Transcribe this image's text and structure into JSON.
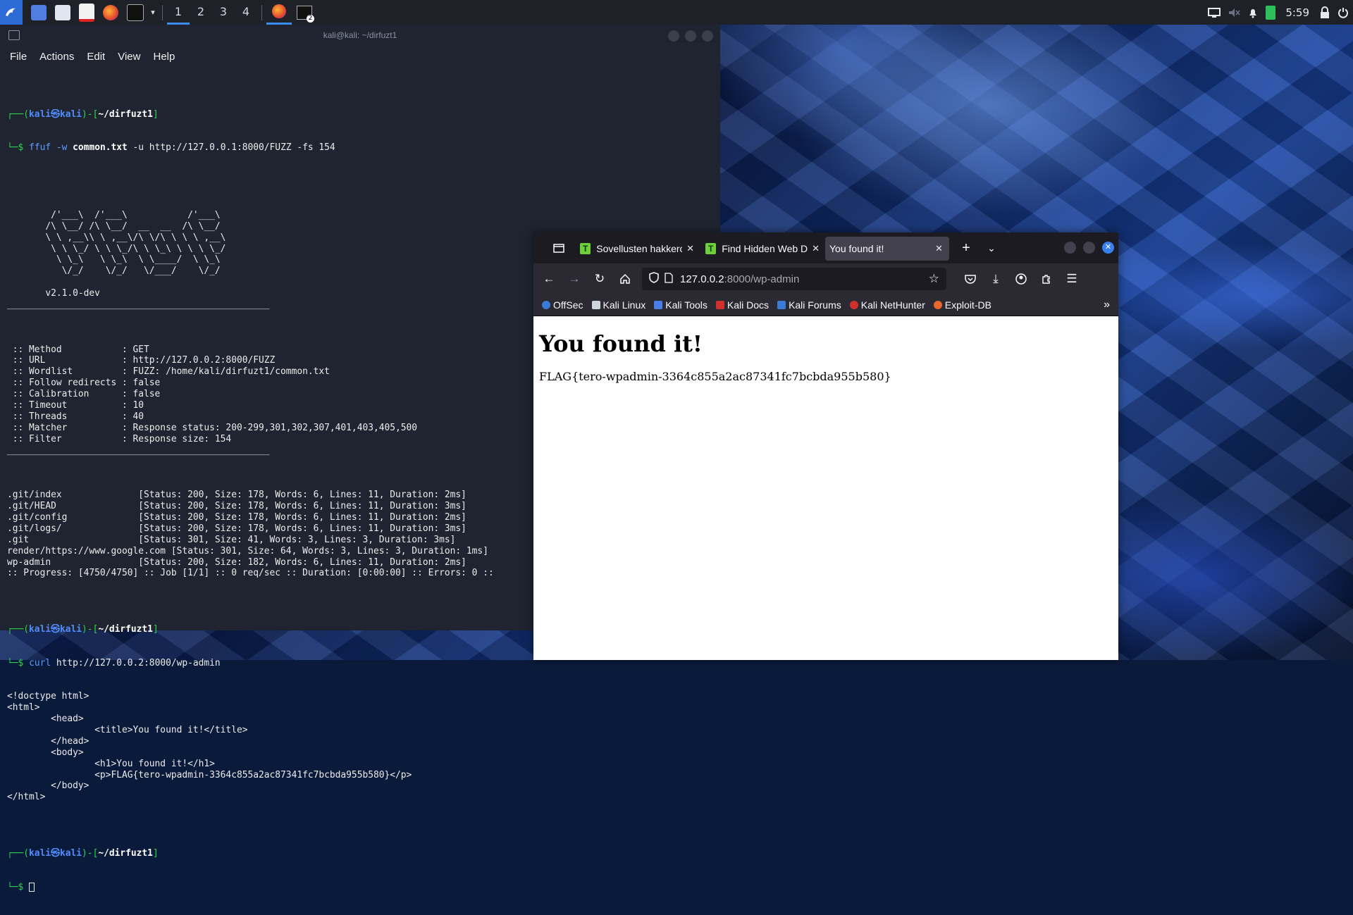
{
  "taskbar": {
    "workspaces": [
      "1",
      "2",
      "3",
      "4"
    ],
    "clock": "5:59",
    "terminal_badge": "2"
  },
  "terminal": {
    "title": "kali@kali: ~/dirfuzt1",
    "menu": [
      "File",
      "Actions",
      "Edit",
      "View",
      "Help"
    ],
    "prompt": {
      "user_host_open": "┌──(",
      "user": "kali",
      "at": "㉿",
      "host": "kali",
      "mid": ")-[",
      "path": "~/dirfuzt1",
      "close": "]",
      "dollar": "└─$"
    },
    "cmd1": {
      "prog": "ffuf",
      "flag1": " -w ",
      "arg1": "common.txt",
      "rest": " -u http://127.0.0.1:8000/FUZZ -fs 154"
    },
    "banner": [
      "        /'___\\  /'___\\           /'___\\",
      "       /\\ \\__/ /\\ \\__/  __  __  /\\ \\__/",
      "       \\ \\ ,__\\\\ \\ ,__\\/\\ \\/\\ \\ \\ \\ ,__\\",
      "        \\ \\ \\_/ \\ \\ \\_/\\ \\ \\_\\ \\ \\ \\ \\_/",
      "         \\ \\_\\   \\ \\_\\  \\ \\____/  \\ \\_\\",
      "          \\/_/    \\/_/   \\/___/    \\/_/",
      "",
      "       v2.1.0-dev",
      "________________________________________________"
    ],
    "config": [
      "",
      " :: Method           : GET",
      " :: URL              : http://127.0.0.2:8000/FUZZ",
      " :: Wordlist         : FUZZ: /home/kali/dirfuzt1/common.txt",
      " :: Follow redirects : false",
      " :: Calibration      : false",
      " :: Timeout          : 10",
      " :: Threads          : 40",
      " :: Matcher          : Response status: 200-299,301,302,307,401,403,405,500",
      " :: Filter           : Response size: 154",
      "________________________________________________",
      ""
    ],
    "results": [
      ".git/index              [Status: 200, Size: 178, Words: 6, Lines: 11, Duration: 2ms]",
      ".git/HEAD               [Status: 200, Size: 178, Words: 6, Lines: 11, Duration: 3ms]",
      ".git/config             [Status: 200, Size: 178, Words: 6, Lines: 11, Duration: 2ms]",
      ".git/logs/              [Status: 200, Size: 178, Words: 6, Lines: 11, Duration: 3ms]",
      ".git                    [Status: 301, Size: 41, Words: 3, Lines: 3, Duration: 3ms]",
      "render/https://www.google.com [Status: 301, Size: 64, Words: 3, Lines: 3, Duration: 1ms]",
      "wp-admin                [Status: 200, Size: 182, Words: 6, Lines: 11, Duration: 2ms]",
      ":: Progress: [4750/4750] :: Job [1/1] :: 0 req/sec :: Duration: [0:00:00] :: Errors: 0 ::",
      ""
    ],
    "cmd2": {
      "prog": "curl",
      "rest": " http://127.0.0.2:8000/wp-admin"
    },
    "curl_output": [
      "<!doctype html>",
      "<html>",
      "        <head>",
      "                <title>You found it!</title>",
      "        </head>",
      "        <body>",
      "                <h1>You found it!</h1>",
      "                <p>FLAG{tero-wpadmin-3364c855a2ac87341fc7bcbda955b580}</p>",
      "        </body>",
      "</html>",
      ""
    ]
  },
  "browser": {
    "tabs": [
      {
        "title": "Sovellusten hakkerointi",
        "favicon": "T"
      },
      {
        "title": "Find Hidden Web Directories",
        "favicon": "T"
      },
      {
        "title": "You found it!"
      }
    ],
    "url_host": "127.0.0.2",
    "url_path": ":8000/wp-admin",
    "bookmarks": [
      "OffSec",
      "Kali Linux",
      "Kali Tools",
      "Kali Docs",
      "Kali Forums",
      "Kali NetHunter",
      "Exploit-DB"
    ],
    "page": {
      "heading": "You found it!",
      "flag": "FLAG{tero-wpadmin-3364c855a2ac87341fc7bcbda955b580}"
    }
  }
}
